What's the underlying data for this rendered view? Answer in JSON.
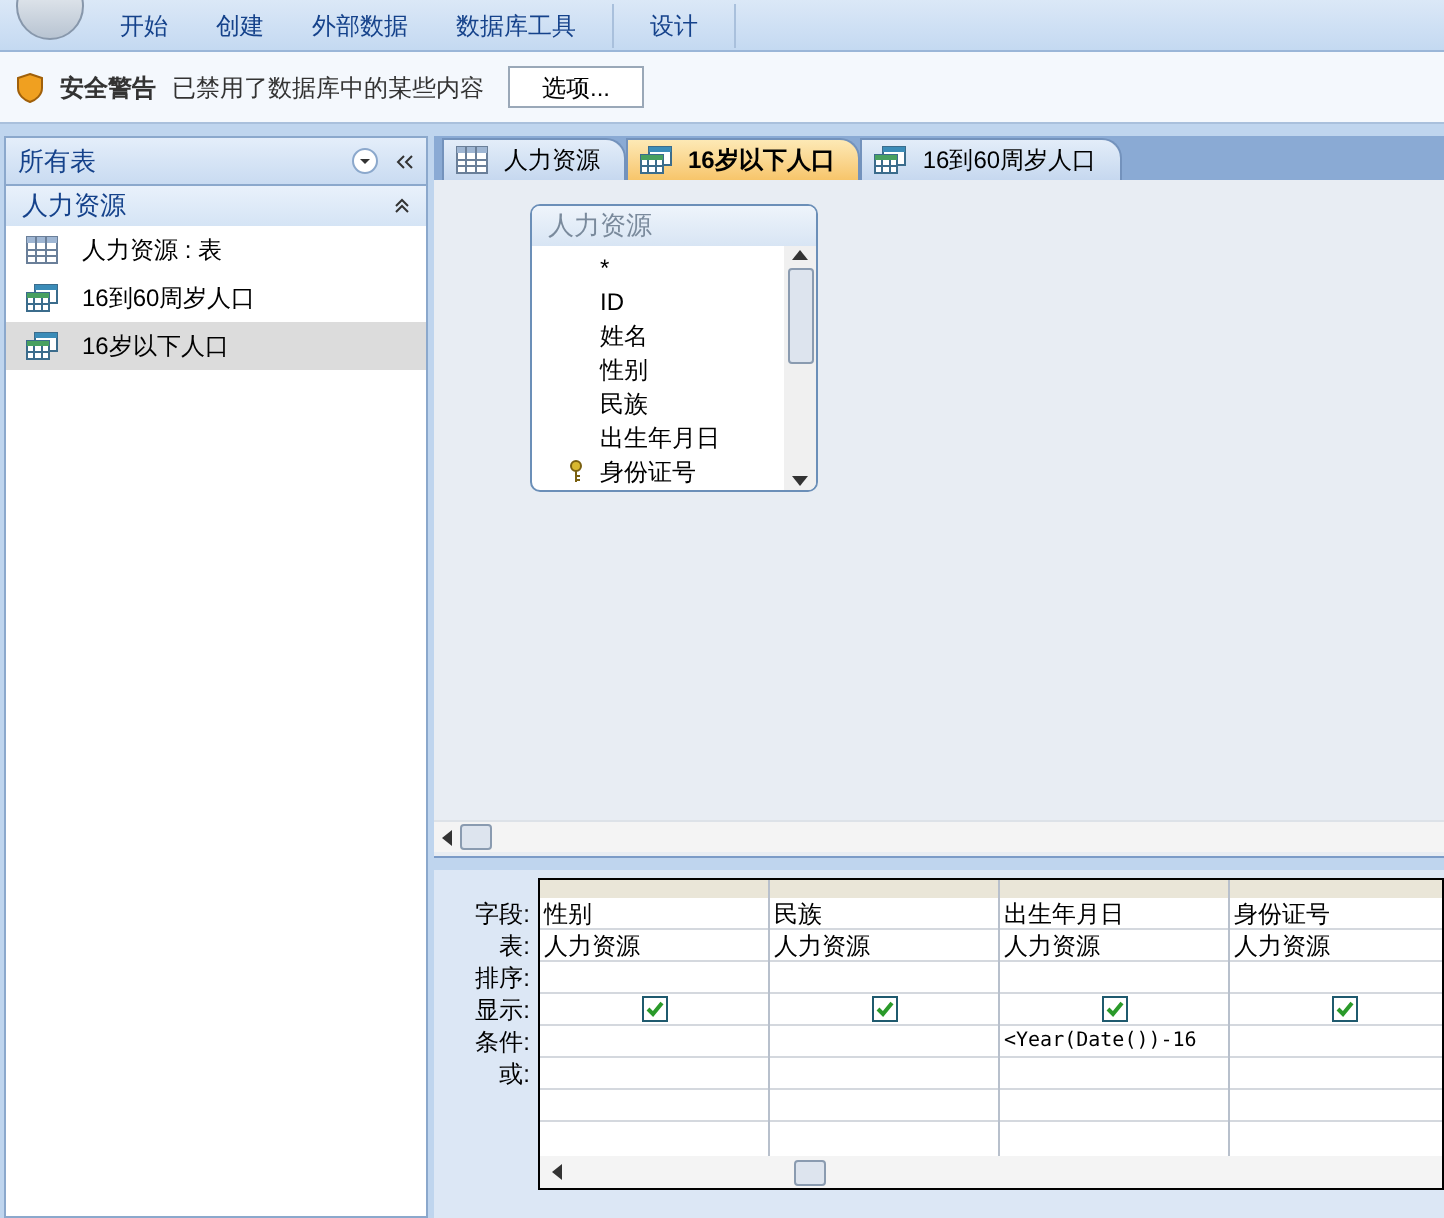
{
  "ribbon_tabs": [
    "开始",
    "创建",
    "外部数据",
    "数据库工具",
    "设计"
  ],
  "security_bar": {
    "title": "安全警告",
    "message": "已禁用了数据库中的某些内容",
    "button": "选项..."
  },
  "navigation": {
    "header": "所有表",
    "group": "人力资源",
    "items": [
      {
        "label": "人力资源 : 表",
        "kind": "table",
        "selected": false
      },
      {
        "label": "16到60周岁人口",
        "kind": "query",
        "selected": false
      },
      {
        "label": "16岁以下人口",
        "kind": "query",
        "selected": true
      }
    ]
  },
  "document_tabs": [
    {
      "label": "人力资源",
      "kind": "table",
      "selected": false
    },
    {
      "label": "16岁以下人口",
      "kind": "query",
      "selected": true
    },
    {
      "label": "16到60周岁人口",
      "kind": "query",
      "selected": false
    }
  ],
  "field_list": {
    "title": "人力资源",
    "fields": [
      {
        "name": "*",
        "primary_key": false
      },
      {
        "name": "ID",
        "primary_key": false
      },
      {
        "name": "姓名",
        "primary_key": false
      },
      {
        "name": "性别",
        "primary_key": false
      },
      {
        "name": "民族",
        "primary_key": false
      },
      {
        "name": "出生年月日",
        "primary_key": false
      },
      {
        "name": "身份证号",
        "primary_key": true
      }
    ]
  },
  "query_grid": {
    "row_labels": [
      "字段:",
      "表:",
      "排序:",
      "显示:",
      "条件:",
      "或:"
    ],
    "columns": [
      {
        "field": "性别",
        "table": "人力资源",
        "show": true
      },
      {
        "field": "民族",
        "table": "人力资源",
        "show": true
      },
      {
        "field": "出生年月日",
        "table": "人力资源",
        "show": true,
        "criteria": "<Year(Date())-16"
      },
      {
        "field": "身份证号",
        "table": "人力资源",
        "show": true
      }
    ]
  }
}
